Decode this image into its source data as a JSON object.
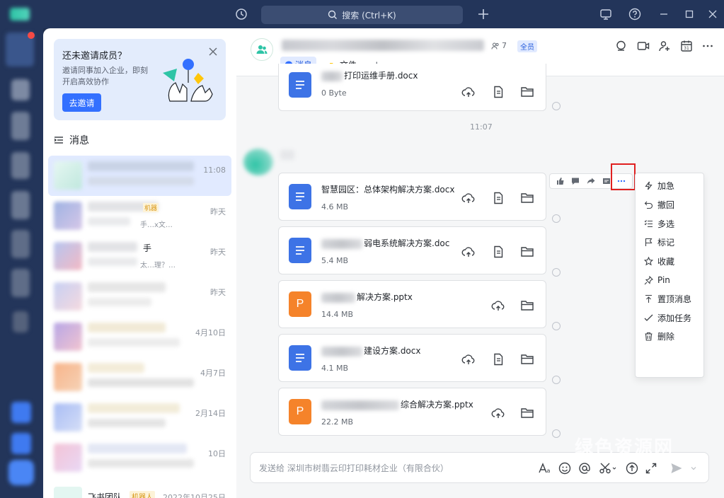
{
  "titlebar": {
    "search_placeholder": "搜索 (Ctrl+K)"
  },
  "invite": {
    "title": "还未邀请成员？",
    "desc_line1": "邀请同事加入企业，即刻",
    "desc_line2": "开启高效协作",
    "button": "去邀请"
  },
  "sidebar": {
    "section_title": "消息",
    "chats": [
      {
        "time": "11:08",
        "active": true
      },
      {
        "time": "昨天",
        "preview_fragment": "手…x文…",
        "badge": "机器"
      },
      {
        "time": "昨天",
        "name_fragment": "手",
        "preview_fragment": "太…理？…"
      },
      {
        "time": "昨天"
      },
      {
        "time": "4月10日"
      },
      {
        "time": "4月7日"
      },
      {
        "time": "2月14日"
      },
      {
        "time": "10日"
      },
      {
        "name": "飞书团队",
        "badge": "机器人",
        "time": "2022年10月25日"
      }
    ]
  },
  "chat_header": {
    "member_count": "7",
    "badge": "全员",
    "tabs": [
      {
        "label": "消息",
        "active": true
      },
      {
        "label": "文件",
        "active": false
      }
    ],
    "add_tab": "+"
  },
  "messages": {
    "top_file": {
      "name": "打印运维手册.docx",
      "size": "0 Byte",
      "type": "doc"
    },
    "time_divider": "11:07",
    "files": [
      {
        "name": "智慧园区：总体架构解决方案.docx",
        "size": "4.6 MB",
        "type": "doc",
        "blurred_prefix": false
      },
      {
        "name": "弱电系统解决方案.doc",
        "size": "5.4 MB",
        "type": "doc",
        "blurred_prefix": true
      },
      {
        "name": "解决方案.pptx",
        "size": "14.4 MB",
        "type": "ppt",
        "blurred_prefix": true
      },
      {
        "name": "建设方案.docx",
        "size": "4.1 MB",
        "type": "doc",
        "blurred_prefix": true
      },
      {
        "name": "综合解决方案.pptx",
        "size": "22.2 MB",
        "type": "ppt",
        "blurred_prefix": true
      }
    ],
    "ppt_letter": "P"
  },
  "context_menu": {
    "items": [
      {
        "label": "加急",
        "icon": "lightning-icon"
      },
      {
        "label": "撤回",
        "icon": "undo-icon"
      },
      {
        "label": "多选",
        "icon": "multi-select-icon"
      },
      {
        "label": "标记",
        "icon": "flag-icon"
      },
      {
        "label": "收藏",
        "icon": "star-icon"
      },
      {
        "label": "Pin",
        "icon": "pin-icon"
      },
      {
        "label": "置顶消息",
        "icon": "pin-top-icon"
      },
      {
        "label": "添加任务",
        "icon": "task-check-icon"
      },
      {
        "label": "删除",
        "icon": "trash-icon"
      }
    ]
  },
  "composer": {
    "placeholder": "发送给 深圳市树翡云印打印耗材企业（有限合伙）"
  },
  "watermark": "绿色资源网",
  "colors": {
    "accent": "#3370ff",
    "doc_blue": "#3d73e6",
    "ppt_orange": "#f5832a",
    "titlebar": "#23355a",
    "highlight_red": "#e02020"
  }
}
